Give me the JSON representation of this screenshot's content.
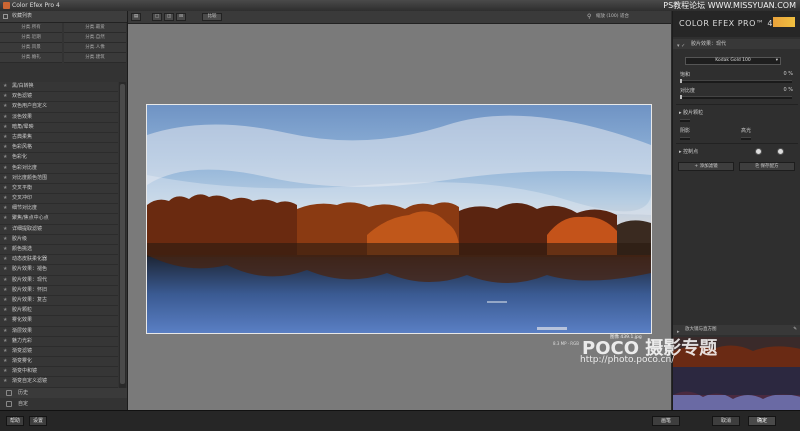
{
  "window": {
    "title": "Color Efex Pro 4",
    "watermark_top": "PS教程论坛 WWW.MISSYUAN.COM"
  },
  "left_panel": {
    "header": "收藏列表",
    "preset_grid": [
      "分类.所有",
      "分类.最爱",
      "分类.近期",
      "分类.自然",
      "分类.风景",
      "分类.人像",
      "分类.婚礼",
      "分类.建筑"
    ],
    "filters": [
      "黑/白转换",
      "双色滤镜",
      "双色用户自定义",
      "淡色效果",
      "暗角/晕映",
      "古典柔焦",
      "色彩风格",
      "色彩化",
      "色彩对比度",
      "对比度颜色范围",
      "交叉平衡",
      "交叉冲印",
      "细节对比度",
      "聚焦/焦点中心点",
      "详细提取滤镜",
      "胶片级",
      "颜色挑选",
      "动态皮肤柔化器",
      "胶片效果：褪色",
      "胶片效果：现代",
      "胶片效果：怀旧",
      "胶片效果：复古",
      "胶片颗粒",
      "雾化效果",
      "渐层效果",
      "魅力光彩",
      "渐变滤镜",
      "渐变雾化",
      "渐变中和镜",
      "渐变自定义滤镜",
      "高调",
      "阴影边缘",
      "印象派风格"
    ],
    "bottom_items": [
      "历史",
      "自定"
    ]
  },
  "toolbar": {
    "view_label": "比较",
    "zoom_text": "缩放 (100) 适合"
  },
  "canvas": {
    "caption": "图像 439.1.jpg",
    "caption_sub": "8.3 MP  ·  RGB"
  },
  "right_panel": {
    "brand": "COLOR EFEX PRO™ 4",
    "section_title": "胶片效果：现代",
    "film_type": "Kodak Gold 100",
    "sliders": [
      {
        "label": "饱和",
        "value": "0 %"
      },
      {
        "label": "对比度",
        "value": "0 %"
      }
    ],
    "fine_tune": "胶片颗粒",
    "shadows_label": "阴影",
    "highlights_label": "高光",
    "control_points_label": "控制点",
    "add_filter_button": "添加滤镜",
    "save_preset_button": "保存配方",
    "loupe_label": "放大镜与直方图"
  },
  "watermark": {
    "brand": "POCO 摄影专题",
    "url": "http://photo.poco.cn/"
  },
  "bottom_bar": {
    "help": "帮助",
    "settings": "设置",
    "brush": "画笔",
    "cancel": "取消",
    "ok": "确定"
  },
  "colors": {
    "accent": "#e9a23b",
    "panel": "#333333",
    "canvas": "#7a7a7a"
  }
}
